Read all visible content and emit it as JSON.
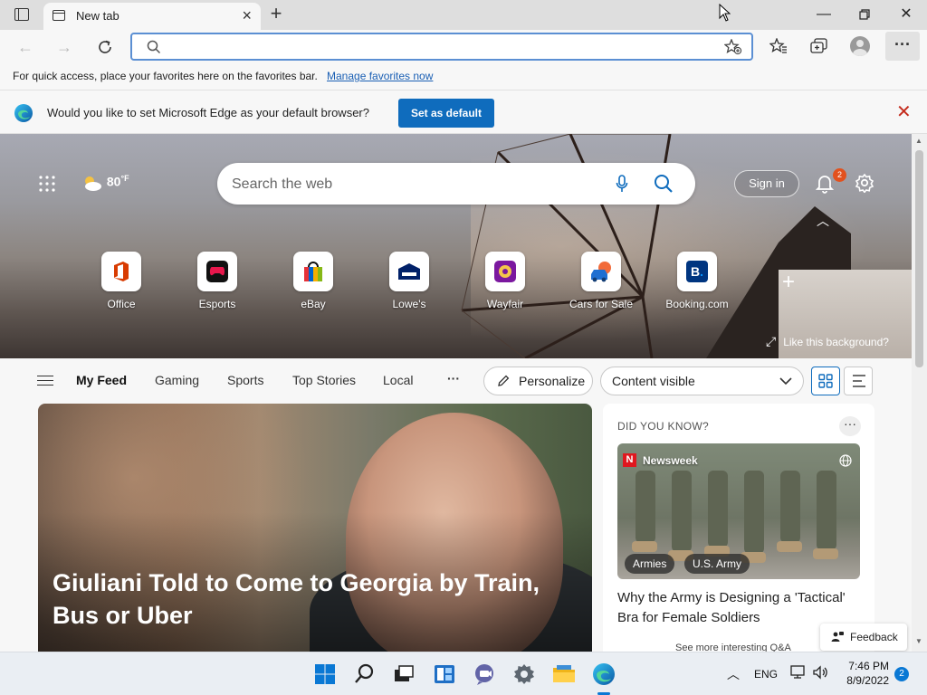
{
  "browser": {
    "tab_title": "New tab",
    "address_placeholder": ""
  },
  "favorites_bar": {
    "message": "For quick access, place your favorites here on the favorites bar.",
    "link": "Manage favorites now"
  },
  "default_prompt": {
    "message": "Would you like to set Microsoft Edge as your default browser?",
    "button": "Set as default"
  },
  "newtab": {
    "weather_temp": "80",
    "weather_unit": "°F",
    "search_placeholder": "Search the web",
    "sign_in": "Sign in",
    "notification_count": "2",
    "quick_links": [
      {
        "label": "Office"
      },
      {
        "label": "Esports"
      },
      {
        "label": "eBay"
      },
      {
        "label": "Lowe's"
      },
      {
        "label": "Wayfair"
      },
      {
        "label": "Cars for Sale"
      },
      {
        "label": "Booking.com"
      }
    ],
    "like_background": "Like this background?"
  },
  "feed_nav": {
    "items": [
      "My Feed",
      "Gaming",
      "Sports",
      "Top Stories",
      "Local"
    ],
    "more": "···",
    "personalize": "Personalize",
    "content_visibility": "Content visible"
  },
  "main_story": {
    "headline": "Giuliani Told to Come to Georgia by Train, Bus or Uber"
  },
  "did_you_know": {
    "title": "DID YOU KNOW?",
    "source": "Newsweek",
    "source_logo_letter": "N",
    "tags": [
      "Armies",
      "U.S. Army"
    ],
    "headline": "Why the Army is Designing a 'Tactical' Bra for Female Soldiers",
    "footer": "See more interesting Q&A"
  },
  "feedback": "Feedback",
  "taskbar": {
    "language": "ENG",
    "time": "7:46 PM",
    "date": "8/9/2022",
    "notifications": "2"
  },
  "colors": {
    "accent": "#0f6cbd",
    "notification_badge": "#e2511d",
    "close_red": "#c42b1c"
  }
}
